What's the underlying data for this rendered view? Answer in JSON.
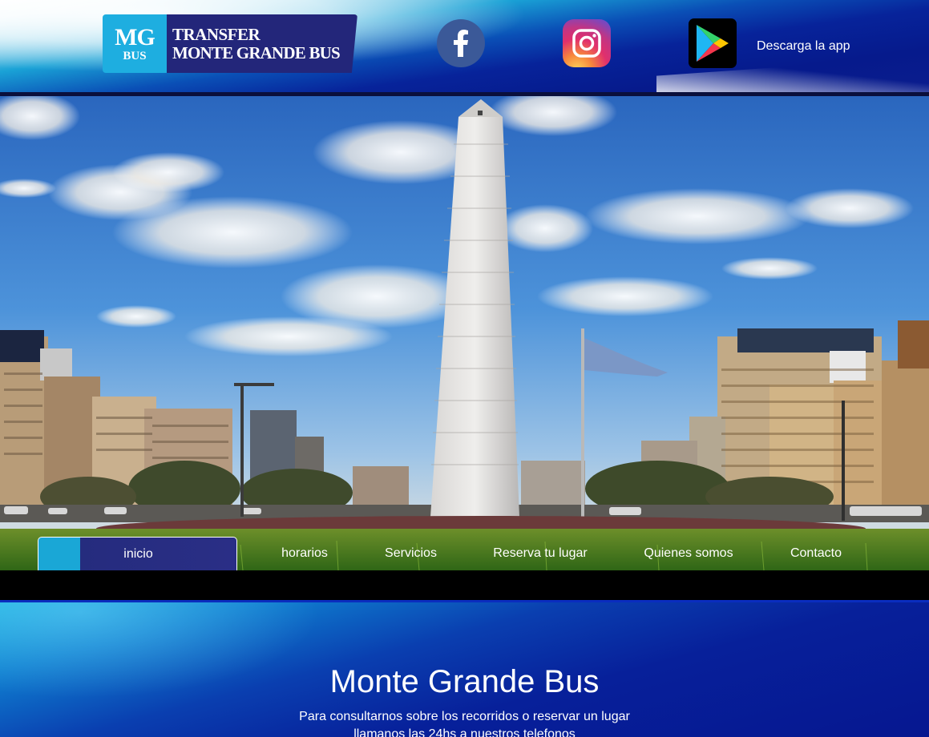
{
  "header": {
    "logo": {
      "initials": "MG",
      "badge_sub": "BUS",
      "line1": "TRANSFER",
      "line2": "MONTE GRANDE BUS"
    },
    "social": [
      {
        "name": "facebook",
        "icon": "facebook-icon",
        "color": "#3b5998"
      },
      {
        "name": "instagram",
        "icon": "instagram-icon"
      },
      {
        "name": "google-play",
        "icon": "google-play-icon"
      }
    ],
    "app_label": "Descarga la app"
  },
  "nav": {
    "items": [
      {
        "label": "inicio",
        "active": true
      },
      {
        "label": "horarios"
      },
      {
        "label": "Servicios"
      },
      {
        "label": "Reserva tu lugar"
      },
      {
        "label": "Quienes somos"
      },
      {
        "label": "Contacto"
      }
    ]
  },
  "main": {
    "title": "Monte Grande Bus",
    "line1": "Para consultarnos sobre los recorridos o reservar un lugar",
    "line2": "llamanos las 24hs a nuestros telefonos"
  },
  "colors": {
    "brand_cyan": "#1eaee0",
    "brand_navy": "#23267a",
    "deep_blue": "#061a8c"
  }
}
